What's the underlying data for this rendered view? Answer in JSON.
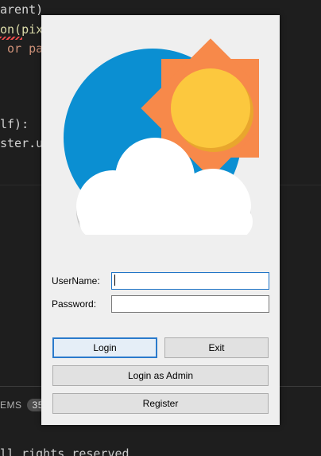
{
  "background": {
    "code_lines": [
      "arent)",
      "on(pix",
      " or pa",
      "lf):",
      "ster.u"
    ],
    "problems_label": "EMS",
    "problems_count": "35",
    "footer_text": "ll rights reserved"
  },
  "dialog": {
    "logo_icon": "partly-cloudy-weather-icon",
    "username_label": "UserName:",
    "username_value": "",
    "password_label": "Password:",
    "password_value": "",
    "buttons": {
      "login": "Login",
      "exit": "Exit",
      "login_admin": "Login as Admin",
      "register": "Register"
    }
  },
  "colors": {
    "circle_blue": "#0b8fd2",
    "sun_rays": "#f7894a",
    "sun_core": "#fcc83e",
    "cloud": "#ffffff",
    "focus_border": "#1e74c6"
  }
}
